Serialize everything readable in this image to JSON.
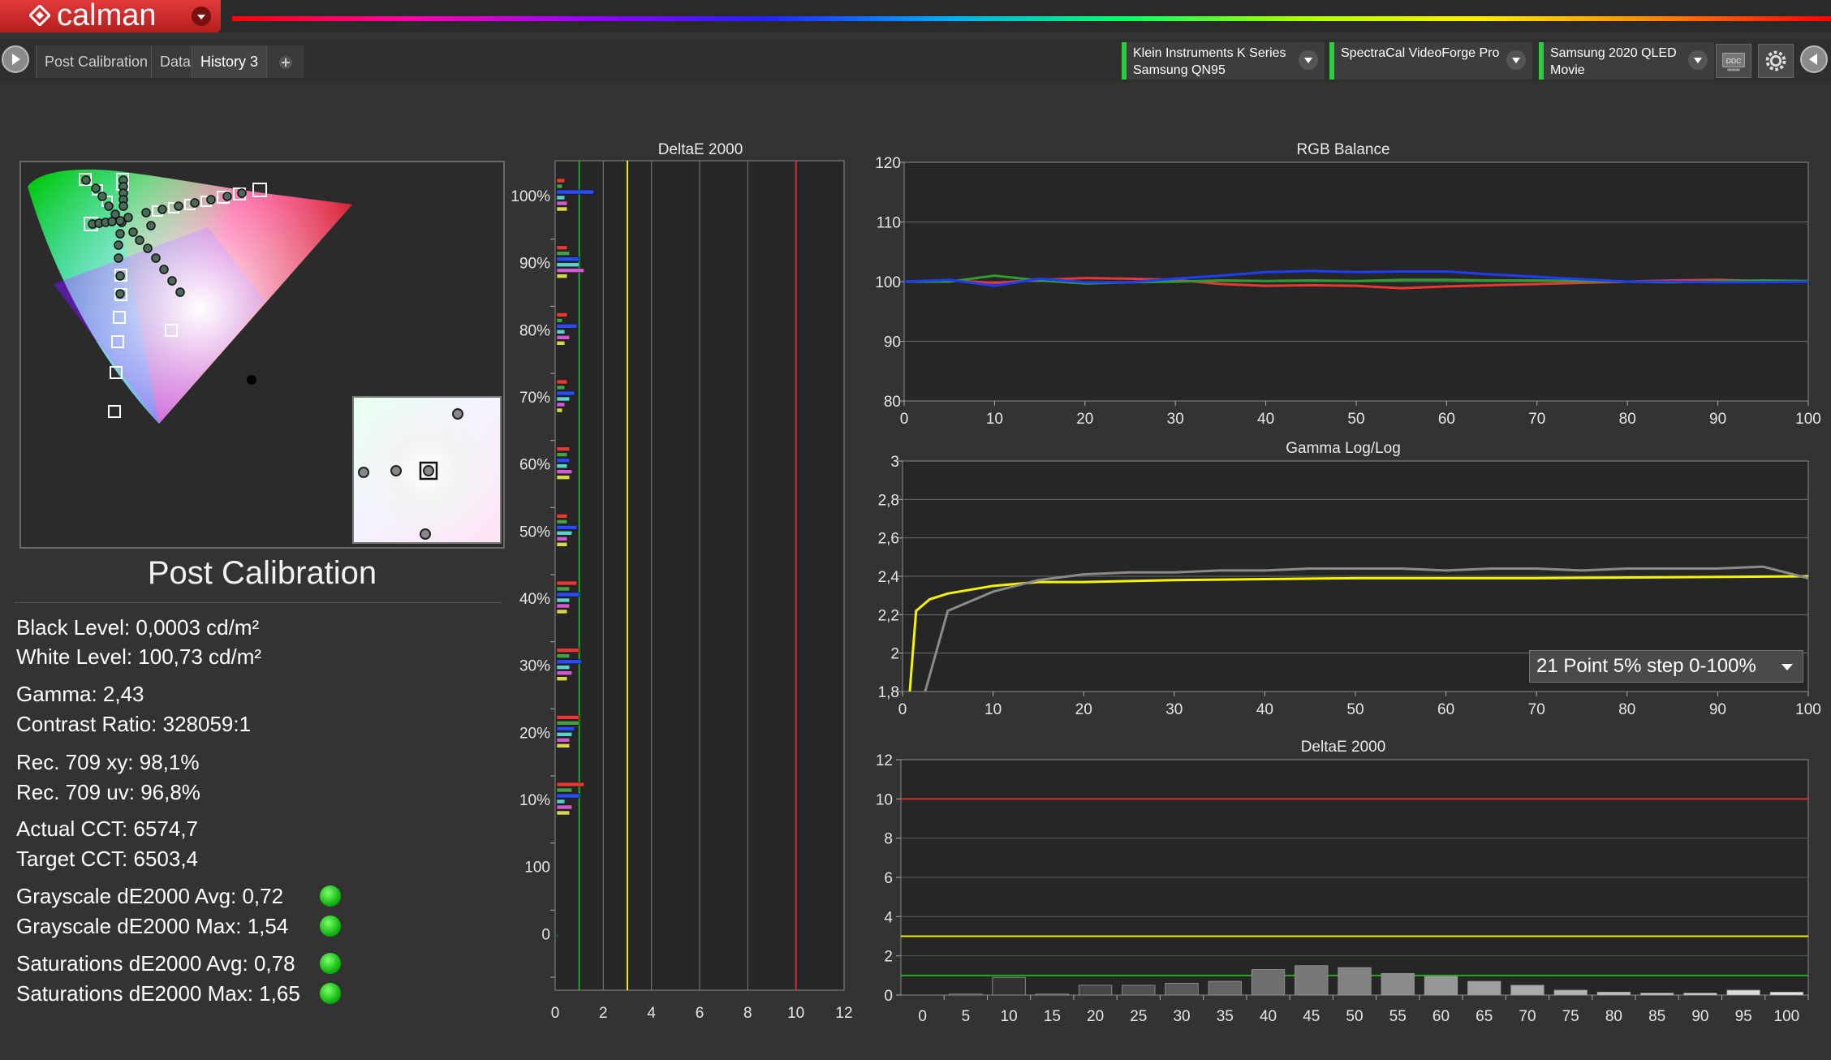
{
  "app": {
    "logo_text": "calman"
  },
  "tabs": [
    {
      "label": "Post Calibration"
    },
    {
      "label": "Data"
    },
    {
      "label": "History 3"
    }
  ],
  "devices": [
    {
      "line1": "Klein Instruments K Series",
      "line2": "Samsung QN95"
    },
    {
      "line1": "SpectraCal VideoForge Pro",
      "line2": ""
    },
    {
      "line1": "Samsung 2020 QLED",
      "line2": "Movie"
    }
  ],
  "ddc_label": "DDC",
  "panel": {
    "title": "Post Calibration",
    "stats": [
      {
        "text": "Black Level: 0,0003 cd/m²"
      },
      {
        "text": "White Level: 100,73 cd/m²"
      },
      {
        "text": "Gamma: 2,43"
      },
      {
        "text": "Contrast Ratio: 328059:1"
      },
      {
        "text": "Rec. 709 xy: 98,1%"
      },
      {
        "text": "Rec. 709 uv: 96,8%"
      },
      {
        "text": "Actual CCT: 6574,7"
      },
      {
        "text": "Target CCT: 6503,4"
      },
      {
        "text": "Grayscale dE2000 Avg: 0,72",
        "status": "green"
      },
      {
        "text": "Grayscale dE2000 Max: 1,54",
        "status": "green"
      },
      {
        "text": "Saturations dE2000 Avg: 0,78",
        "status": "green"
      },
      {
        "text": "Saturations dE2000 Max: 1,65",
        "status": "green"
      }
    ]
  },
  "gamma_dropdown": {
    "value": "21 Point 5% step 0-100%"
  },
  "colors": {
    "accent_red": "#d32f2f",
    "status_green": "#22c322",
    "target_yellow": "#f5f500"
  },
  "chart_data": [
    {
      "id": "deltae-saturation",
      "type": "bar",
      "title": "DeltaE 2000",
      "orientation": "horizontal",
      "categories": [
        "100%",
        "90%",
        "80%",
        "70%",
        "60%",
        "50%",
        "40%",
        "30%",
        "20%",
        "10%",
        "100",
        "0"
      ],
      "x_ticks": [
        0,
        2,
        4,
        6,
        8,
        10,
        12
      ],
      "xlim": [
        0,
        12
      ],
      "thresholds": [
        {
          "value": 1,
          "color": "green"
        },
        {
          "value": 3,
          "color": "yellow"
        },
        {
          "value": 10,
          "color": "red"
        }
      ],
      "series": [
        {
          "color": "red",
          "values": [
            0.4,
            0.5,
            0.5,
            0.5,
            0.6,
            0.5,
            0.9,
            1.0,
            1.0,
            1.2,
            0,
            0
          ]
        },
        {
          "color": "green",
          "values": [
            0.3,
            0.6,
            0.3,
            0.4,
            0.5,
            0.5,
            0.6,
            0.6,
            1.0,
            0.7,
            0,
            0
          ]
        },
        {
          "color": "blue",
          "values": [
            1.6,
            1.0,
            0.9,
            0.8,
            0.6,
            0.9,
            1.0,
            1.1,
            0.8,
            1.0,
            0,
            0
          ]
        },
        {
          "color": "cyan",
          "values": [
            0.4,
            1.0,
            0.4,
            0.6,
            0.5,
            0.7,
            0.6,
            0.6,
            0.7,
            0.4,
            0,
            0.1
          ]
        },
        {
          "color": "magenta",
          "values": [
            0.5,
            1.2,
            0.6,
            0.4,
            0.7,
            0.5,
            0.6,
            0.7,
            0.6,
            0.7,
            0,
            0
          ]
        },
        {
          "color": "yellow",
          "values": [
            0.5,
            0.5,
            0.4,
            0.3,
            0.6,
            0.5,
            0.5,
            0.5,
            0.6,
            0.6,
            0,
            0
          ]
        }
      ]
    },
    {
      "id": "rgb-balance",
      "type": "line",
      "title": "RGB Balance",
      "x": [
        0,
        5,
        10,
        15,
        20,
        25,
        30,
        35,
        40,
        45,
        50,
        55,
        60,
        65,
        70,
        75,
        80,
        85,
        90,
        95,
        100
      ],
      "xlim": [
        0,
        100
      ],
      "ylim": [
        80,
        120
      ],
      "x_ticks": [
        0,
        10,
        20,
        30,
        40,
        50,
        60,
        70,
        80,
        90,
        100
      ],
      "y_ticks": [
        80,
        90,
        100,
        110,
        120
      ],
      "series": [
        {
          "color": "#e53935",
          "values": [
            100,
            100.2,
            99.8,
            100.3,
            100.6,
            100.5,
            100.3,
            99.6,
            99.3,
            99.4,
            99.3,
            98.9,
            99.2,
            99.4,
            99.6,
            99.8,
            100,
            100.2,
            100.3,
            100.1,
            100
          ]
        },
        {
          "color": "#2e9e2e",
          "values": [
            100,
            100,
            101,
            100.2,
            99.7,
            99.9,
            100,
            100.2,
            100.1,
            100.2,
            100.1,
            100.3,
            100.3,
            100.2,
            100.2,
            100.1,
            100,
            99.9,
            100.1,
            100.2,
            100.1
          ]
        },
        {
          "color": "#1e3cff",
          "values": [
            100,
            100.3,
            99.3,
            100.5,
            99.9,
            99.9,
            100.5,
            101,
            101.6,
            101.8,
            101.6,
            101.7,
            101.7,
            101.2,
            100.8,
            100.4,
            100,
            100,
            99.9,
            99.9,
            100
          ]
        }
      ]
    },
    {
      "id": "gamma-loglog",
      "type": "line",
      "title": "Gamma Log/Log",
      "xlim": [
        0,
        100
      ],
      "ylim": [
        1.8,
        3
      ],
      "x_ticks": [
        0,
        10,
        20,
        30,
        40,
        50,
        60,
        70,
        80,
        90,
        100
      ],
      "y_ticks": [
        "1,8",
        "2",
        "2,2",
        "2,4",
        "2,6",
        "2,8",
        "3"
      ],
      "series": [
        {
          "name": "target",
          "color": "#f5f500",
          "x": [
            0.8,
            1.5,
            3,
            5,
            7.5,
            10,
            15,
            20,
            30,
            50,
            70,
            100
          ],
          "values": [
            1.8,
            2.22,
            2.28,
            2.31,
            2.33,
            2.35,
            2.37,
            2.37,
            2.38,
            2.39,
            2.39,
            2.4
          ]
        },
        {
          "name": "measured",
          "color": "#8a8a8a",
          "x": [
            2.5,
            5,
            10,
            15,
            20,
            25,
            30,
            35,
            40,
            45,
            50,
            55,
            60,
            65,
            70,
            75,
            80,
            85,
            90,
            95,
            100
          ],
          "values": [
            1.8,
            2.22,
            2.32,
            2.38,
            2.41,
            2.42,
            2.42,
            2.43,
            2.43,
            2.44,
            2.44,
            2.44,
            2.43,
            2.44,
            2.44,
            2.43,
            2.44,
            2.44,
            2.44,
            2.45,
            2.39
          ]
        }
      ]
    },
    {
      "id": "deltae-grayscale",
      "type": "bar",
      "title": "DeltaE 2000",
      "categories": [
        "0",
        "5",
        "10",
        "15",
        "20",
        "25",
        "30",
        "35",
        "40",
        "45",
        "50",
        "55",
        "60",
        "65",
        "70",
        "75",
        "80",
        "85",
        "90",
        "95",
        "100"
      ],
      "values": [
        0,
        0.05,
        0.9,
        0.05,
        0.5,
        0.5,
        0.6,
        0.7,
        1.3,
        1.5,
        1.4,
        1.1,
        0.95,
        0.7,
        0.5,
        0.25,
        0.15,
        0.1,
        0.1,
        0.25,
        0.15
      ],
      "ylim": [
        0,
        12
      ],
      "y_ticks": [
        0,
        2,
        4,
        6,
        8,
        10,
        12
      ],
      "thresholds": [
        {
          "value": 1,
          "color": "green"
        },
        {
          "value": 3,
          "color": "yellow"
        },
        {
          "value": 10,
          "color": "red"
        }
      ]
    }
  ]
}
